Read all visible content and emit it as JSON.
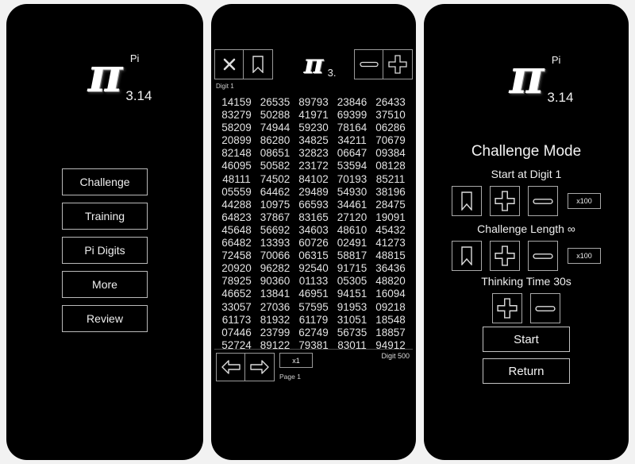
{
  "app": {
    "logo_symbol": "π",
    "logo_sup": "Pi",
    "logo_sub": "3.14",
    "logo_sub_short": "3."
  },
  "screen_home": {
    "menu": [
      {
        "label": "Challenge",
        "name": "challenge"
      },
      {
        "label": "Training",
        "name": "training"
      },
      {
        "label": "Pi Digits",
        "name": "pi-digits"
      },
      {
        "label": "More",
        "name": "more"
      },
      {
        "label": "Review",
        "name": "review"
      }
    ]
  },
  "screen_digits": {
    "close_icon": "close-icon",
    "bookmark_icon": "bookmark-icon",
    "minus_icon": "minus-icon",
    "plus_icon": "plus-icon",
    "start_digit_label": "Digit 1",
    "end_digit_label": "Digit 500",
    "multiplier_label": "x1",
    "page_label": "Page 1",
    "prev_icon": "arrow-left-icon",
    "next_icon": "arrow-right-icon",
    "digit_rows": [
      [
        "14159",
        "26535",
        "89793",
        "23846",
        "26433"
      ],
      [
        "83279",
        "50288",
        "41971",
        "69399",
        "37510"
      ],
      [
        "58209",
        "74944",
        "59230",
        "78164",
        "06286"
      ],
      [
        "20899",
        "86280",
        "34825",
        "34211",
        "70679"
      ],
      [
        "82148",
        "08651",
        "32823",
        "06647",
        "09384"
      ],
      [
        "46095",
        "50582",
        "23172",
        "53594",
        "08128"
      ],
      [
        "48111",
        "74502",
        "84102",
        "70193",
        "85211"
      ],
      [
        "05559",
        "64462",
        "29489",
        "54930",
        "38196"
      ],
      [
        "44288",
        "10975",
        "66593",
        "34461",
        "28475"
      ],
      [
        "64823",
        "37867",
        "83165",
        "27120",
        "19091"
      ],
      [
        "45648",
        "56692",
        "34603",
        "48610",
        "45432"
      ],
      [
        "66482",
        "13393",
        "60726",
        "02491",
        "41273"
      ],
      [
        "72458",
        "70066",
        "06315",
        "58817",
        "48815"
      ],
      [
        "20920",
        "96282",
        "92540",
        "91715",
        "36436"
      ],
      [
        "78925",
        "90360",
        "01133",
        "05305",
        "48820"
      ],
      [
        "46652",
        "13841",
        "46951",
        "94151",
        "16094"
      ],
      [
        "33057",
        "27036",
        "57595",
        "91953",
        "09218"
      ],
      [
        "61173",
        "81932",
        "61179",
        "31051",
        "18548"
      ],
      [
        "07446",
        "23799",
        "62749",
        "56735",
        "18857"
      ],
      [
        "52724",
        "89122",
        "79381",
        "83011",
        "94912"
      ]
    ]
  },
  "screen_challenge": {
    "title": "Challenge Mode",
    "start_digit": {
      "label": "Start at Digit 1",
      "bookmark_icon": "bookmark-icon",
      "plus_icon": "plus-icon",
      "minus_icon": "minus-icon",
      "multiplier_label": "x100"
    },
    "challenge_length": {
      "label": "Challenge Length ∞",
      "bookmark_icon": "bookmark-icon",
      "plus_icon": "plus-icon",
      "minus_icon": "minus-icon",
      "multiplier_label": "x100"
    },
    "thinking_time": {
      "label": "Thinking Time 30s",
      "plus_icon": "plus-icon",
      "minus_icon": "minus-icon"
    },
    "start_label": "Start",
    "return_label": "Return"
  },
  "colors": {
    "background": "#f2f2f2",
    "panel": "#000000",
    "text": "#efefef",
    "border": "#b0b0b0"
  }
}
